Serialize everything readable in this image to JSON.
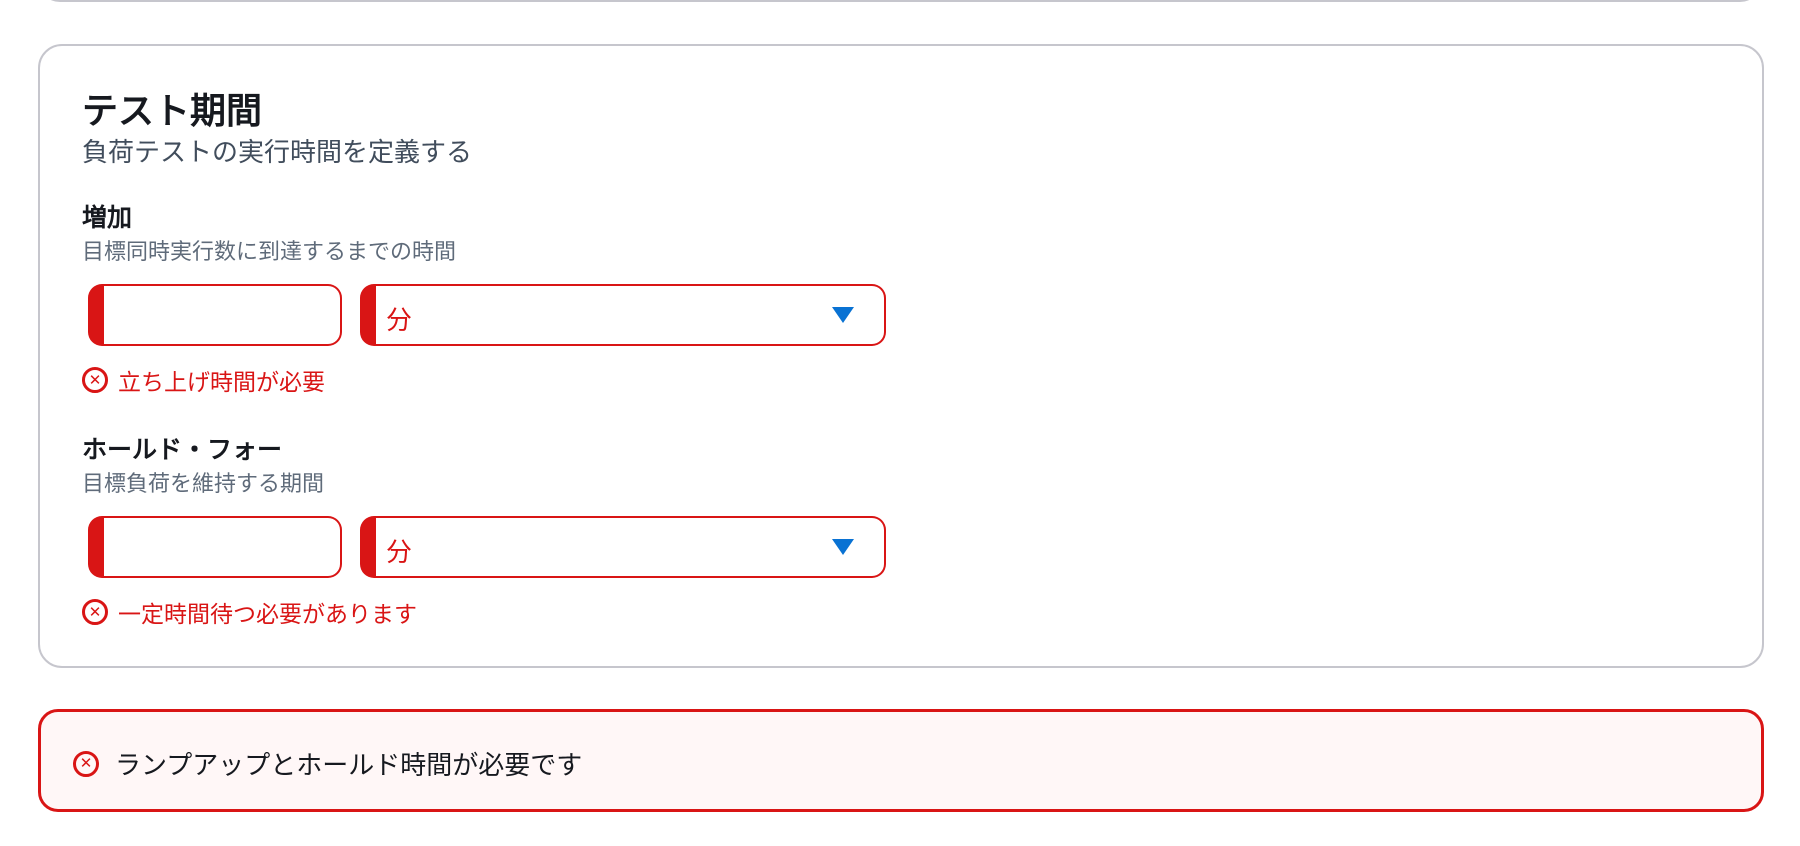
{
  "panel": {
    "title": "テスト期間",
    "description": "負荷テストの実行時間を定義する"
  },
  "ramp_up": {
    "label": "増加",
    "description": "目標同時実行数に到達するまでの時間",
    "value": "",
    "unit": "分",
    "error": "立ち上げ時間が必要"
  },
  "hold_for": {
    "label": "ホールド・フォー",
    "description": "目標負荷を維持する期間",
    "value": "",
    "unit": "分",
    "error": "一定時間待つ必要があります"
  },
  "alert": {
    "message": "ランプアップとホールド時間が必要です"
  },
  "icons": {
    "error": "error-x-circle-icon",
    "dropdown": "caret-down-icon"
  },
  "colors": {
    "error": "#d91515",
    "accent": "#0972d3",
    "alert_background": "#fff7f7",
    "border": "#c6c6cd"
  }
}
